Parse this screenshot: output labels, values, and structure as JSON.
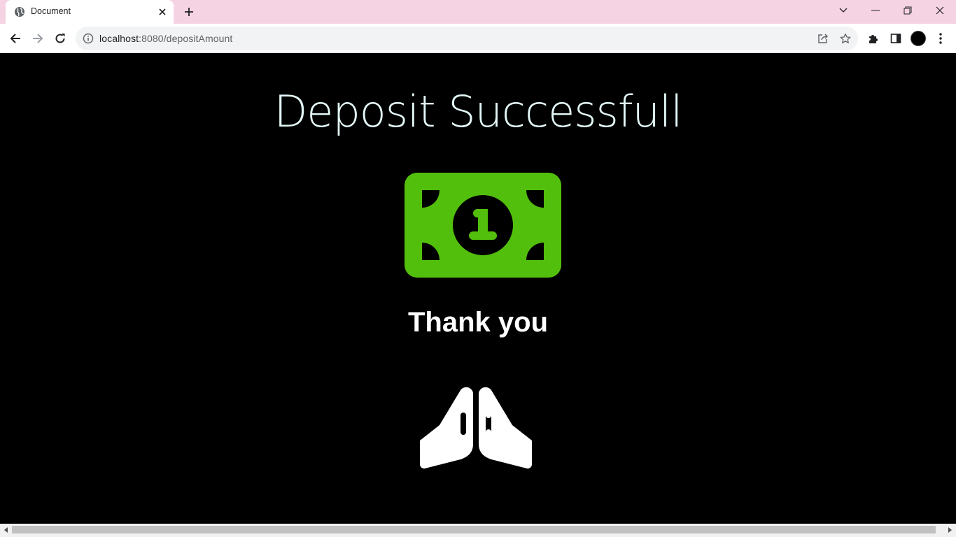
{
  "browser": {
    "tab_title": "Document",
    "url_host": "localhost",
    "url_path": ":8080/depositAmount",
    "icons": {
      "favicon": "globe-icon",
      "tab_close": "close-icon",
      "new_tab": "plus-icon",
      "tab_search": "chevron-down-icon",
      "minimize": "minimize-icon",
      "restore": "restore-icon",
      "close_window": "close-icon",
      "back": "back-arrow-icon",
      "forward": "forward-arrow-icon",
      "reload": "reload-icon",
      "site_info": "info-icon",
      "share": "share-icon",
      "bookmark": "star-icon",
      "extensions": "puzzle-icon",
      "side_panel": "side-panel-icon",
      "menu": "kebab-menu-icon"
    },
    "colors": {
      "tabstrip": "#f6d3e3",
      "omnibox": "#f1f3f4"
    }
  },
  "page": {
    "heading": "Deposit Successfull",
    "message": "Thank you",
    "icons": {
      "money": "banknote-icon",
      "hands": "praying-hands-icon"
    },
    "colors": {
      "background": "#000000",
      "money_icon": "#52bf0c",
      "hands_icon": "#ffffff",
      "heading": "#e3f7f7"
    }
  }
}
